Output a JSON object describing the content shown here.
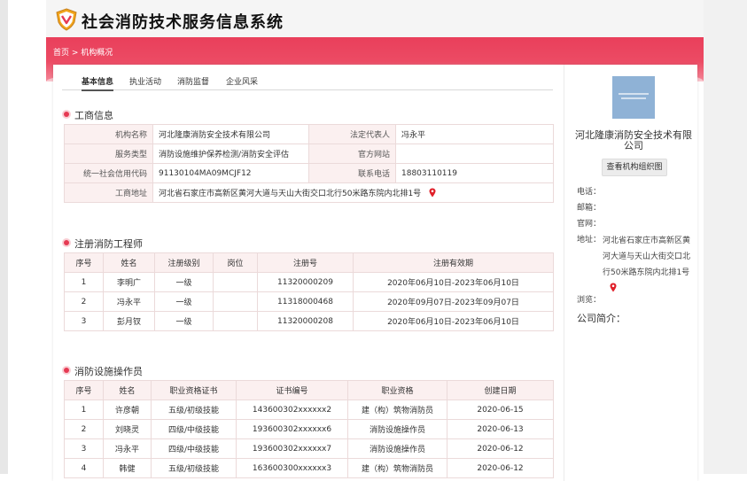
{
  "header": {
    "title": "社会消防技术服务信息系统",
    "logo_icon": "shield-logo-icon"
  },
  "breadcrumb": {
    "home": "首页",
    "separator": " > ",
    "current": "机构概况"
  },
  "tabs": [
    "基本信息",
    "执业活动",
    "消防监督",
    "企业风采"
  ],
  "business_info": {
    "title": "工商信息",
    "org_name_label": "机构名称",
    "org_name": "河北隆康消防安全技术有限公司",
    "legal_rep_label": "法定代表人",
    "legal_rep": "冯永平",
    "service_type_label": "服务类型",
    "service_type": "消防设施维护保养检测/消防安全评估",
    "website_label": "官方网站",
    "website": "",
    "credit_code_label": "统一社会信用代码",
    "credit_code": "91130104MA09MCJF12",
    "phone_label": "联系电话",
    "phone": "18803110119",
    "address_label": "工商地址",
    "address": "河北省石家庄市高新区黄河大道与天山大街交口北行50米路东院内北排1号"
  },
  "engineers": {
    "title": "注册消防工程师",
    "headers": [
      "序号",
      "姓名",
      "注册级别",
      "岗位",
      "注册号",
      "注册有效期"
    ],
    "rows": [
      [
        "1",
        "李明广",
        "一级",
        "",
        "11320000209",
        "2020年06月10日-2023年06月10日"
      ],
      [
        "2",
        "冯永平",
        "一级",
        "",
        "11318000468",
        "2020年09月07日-2023年09月07日"
      ],
      [
        "3",
        "彭月钗",
        "一级",
        "",
        "11320000208",
        "2020年06月10日-2023年06月10日"
      ]
    ]
  },
  "operators": {
    "title": "消防设施操作员",
    "headers": [
      "序号",
      "姓名",
      "职业资格证书",
      "证书编号",
      "职业资格",
      "创建日期"
    ],
    "rows": [
      [
        "1",
        "许彦朝",
        "五级/初级技能",
        "143600302xxxxxx2",
        "建（构）筑物消防员",
        "2020-06-15"
      ],
      [
        "2",
        "刘晓灵",
        "四级/中级技能",
        "193600302xxxxxx6",
        "消防设施操作员",
        "2020-06-13"
      ],
      [
        "3",
        "冯永平",
        "四级/中级技能",
        "193600302xxxxxx7",
        "消防设施操作员",
        "2020-06-12"
      ],
      [
        "4",
        "韩健",
        "五级/初级技能",
        "163600300xxxxxx3",
        "建（构）筑物消防员",
        "2020-06-12"
      ]
    ]
  },
  "sidebar": {
    "org_name": "河北隆康消防安全技术有限公司",
    "org_chart_button": "查看机构组织图",
    "phone_label": "电话：",
    "email_label": "邮箱：",
    "website_label": "官网：",
    "address_label": "地址：",
    "address": "河北省石家庄市高新区黄河大道与天山大街交口北行50米路东院内北排1号",
    "views_label": "浏览：",
    "intro_label": "公司简介："
  },
  "colors": {
    "brand_red": "#e93f5b",
    "table_header_bg": "#fbf0f0",
    "pin_red": "#e0202a"
  }
}
